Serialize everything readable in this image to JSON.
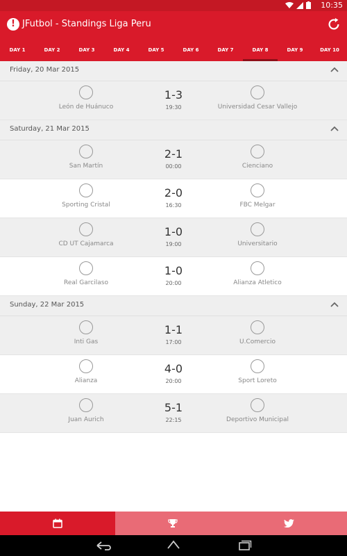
{
  "status": {
    "time": "10:35"
  },
  "app": {
    "title": "JFutbol - Standings Liga Peru"
  },
  "tabs": [
    "DAY 1",
    "DAY 2",
    "DAY 3",
    "DAY 4",
    "DAY 5",
    "DAY 6",
    "DAY 7",
    "DAY 8",
    "DAY 9",
    "DAY 10"
  ],
  "active_tab": "DAY 8",
  "days": [
    {
      "date": "Friday, 20 Mar 2015",
      "matches": [
        {
          "home": "León de Huánuco",
          "away": "Universidad Cesar Vallejo",
          "score": "1-3",
          "time": "19:30"
        }
      ]
    },
    {
      "date": "Saturday, 21 Mar 2015",
      "matches": [
        {
          "home": "San Martín",
          "away": "Cienciano",
          "score": "2-1",
          "time": "00:00"
        },
        {
          "home": "Sporting Cristal",
          "away": "FBC Melgar",
          "score": "2-0",
          "time": "16:30"
        },
        {
          "home": "CD UT Cajamarca",
          "away": "Universitario",
          "score": "1-0",
          "time": "19:00"
        },
        {
          "home": "Real Garcilaso",
          "away": "Alianza Atletico",
          "score": "1-0",
          "time": "20:00"
        }
      ]
    },
    {
      "date": "Sunday, 22 Mar 2015",
      "matches": [
        {
          "home": "Inti Gas",
          "away": "U.Comercio",
          "score": "1-1",
          "time": "17:00"
        },
        {
          "home": "Alianza",
          "away": "Sport Loreto",
          "score": "4-0",
          "time": "20:00"
        },
        {
          "home": "Juan Aurich",
          "away": "Deportivo Municipal",
          "score": "5-1",
          "time": "22:15"
        }
      ]
    }
  ],
  "colors": {
    "primary": "#d91a2a",
    "primary_dark": "#c41824",
    "tab_indicator": "#8e0f18",
    "nav_inactive": "#e96b76"
  },
  "icons": {
    "bottom_nav": [
      "calendar-icon",
      "trophy-icon",
      "twitter-icon"
    ],
    "system_nav": [
      "back-icon",
      "home-icon",
      "recents-icon"
    ]
  }
}
